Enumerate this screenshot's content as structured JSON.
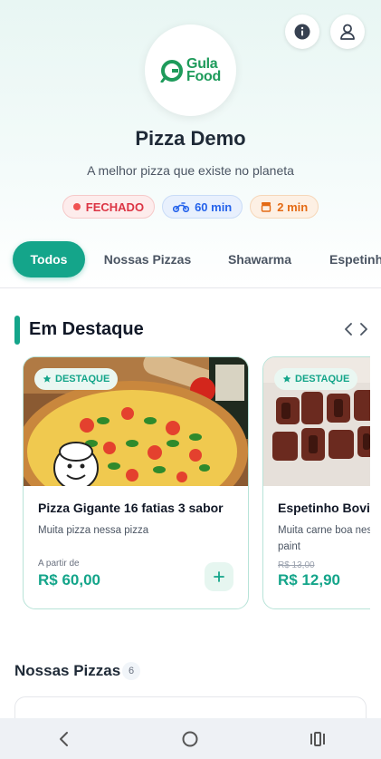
{
  "store": {
    "logo_line1": "Gula",
    "logo_line2": "Food",
    "name": "Pizza Demo",
    "subtitle": "A melhor pizza que existe no planeta"
  },
  "status_chips": [
    {
      "label": "FECHADO",
      "color": "#dc3545"
    },
    {
      "label": "60 min",
      "icon": "motorcycle-icon",
      "color": "#2563eb"
    },
    {
      "label": "2 min",
      "icon": "store-icon",
      "color": "#e46a14"
    }
  ],
  "tabs": [
    {
      "label": "Todos",
      "active": true
    },
    {
      "label": "Nossas Pizzas"
    },
    {
      "label": "Shawarma"
    },
    {
      "label": "Espetinhos"
    }
  ],
  "featured": {
    "title": "Em Destaque",
    "items": [
      {
        "badge": "DESTAQUE",
        "name": "Pizza Gigante 16 fatias 3 sabor",
        "description": "Muita pizza nessa pizza",
        "price_prefix": "A partir de",
        "price": "R$ 60,00"
      },
      {
        "badge": "DESTAQUE",
        "name": "Espetinho Bovino",
        "description": "Muita carne boa nessa pura picanha do paint",
        "old_price": "R$ 13,00",
        "price": "R$ 12,90"
      }
    ]
  },
  "list": {
    "title": "Nossas Pizzas",
    "count": "6"
  },
  "colors": {
    "accent": "#14a58a",
    "closed": "#dc3545",
    "delivery": "#2563eb",
    "pickup": "#e46a14"
  }
}
